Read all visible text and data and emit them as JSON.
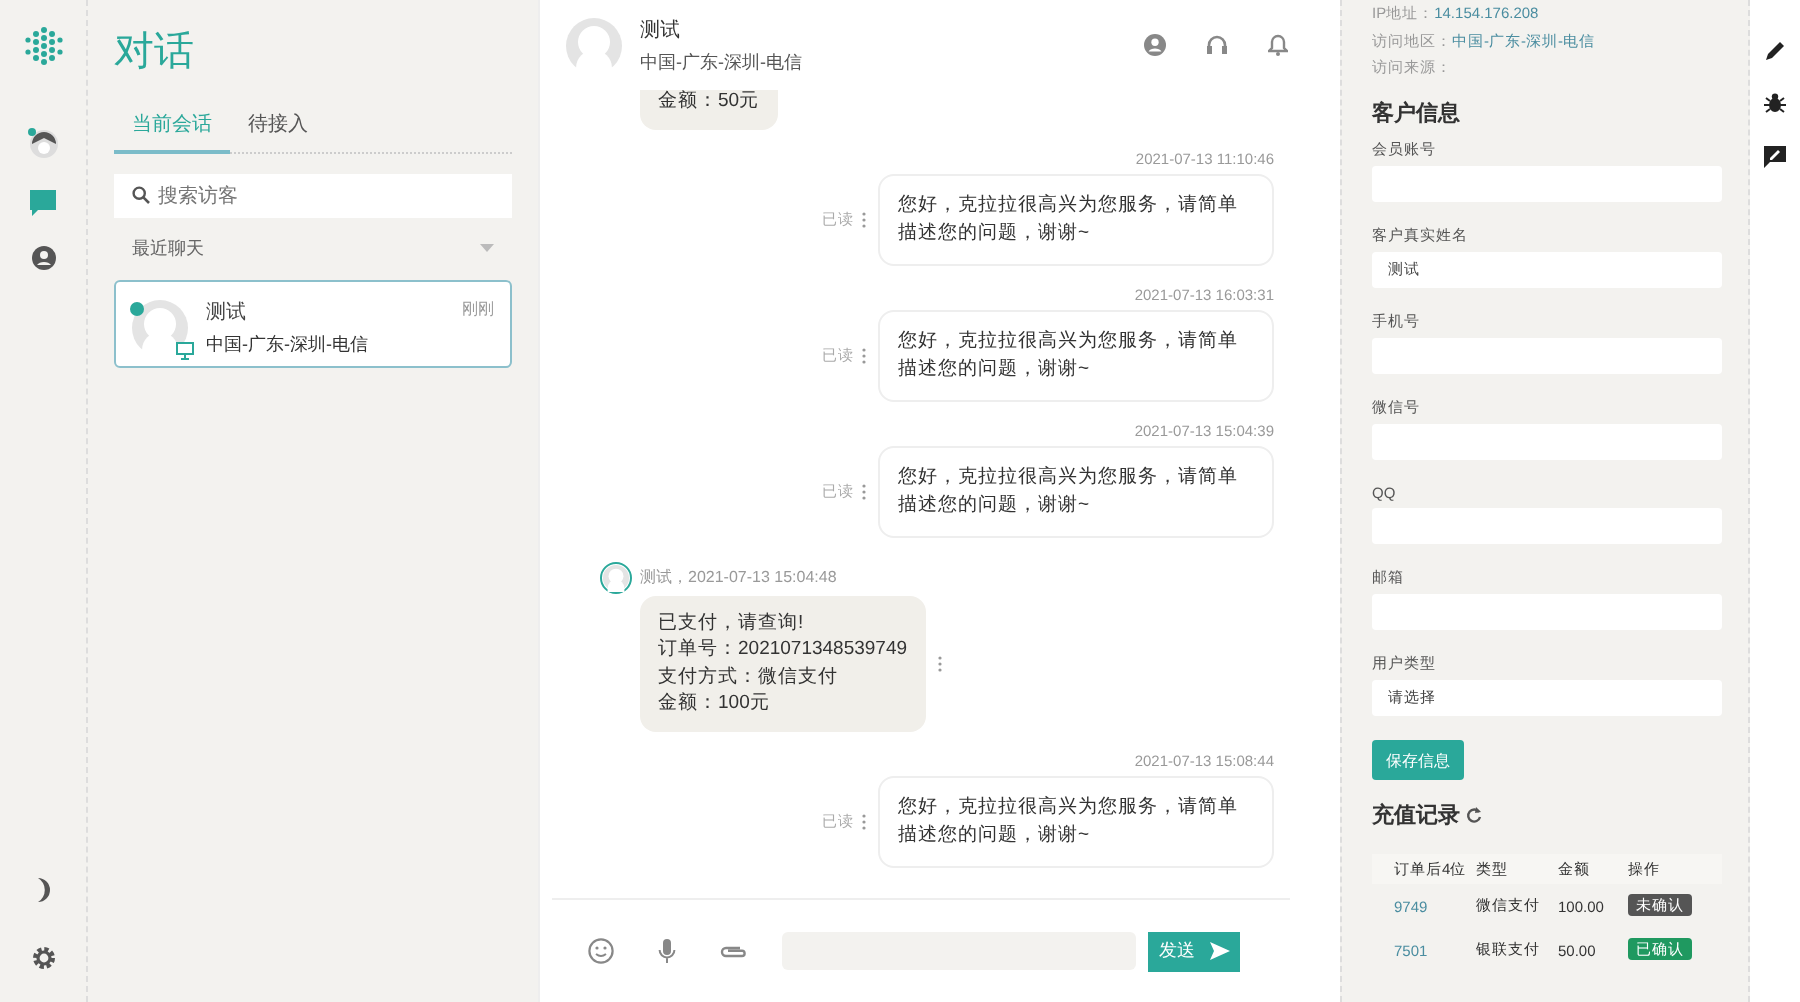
{
  "rail": {
    "items": [
      {
        "kind": "avatar",
        "selected": false
      },
      {
        "kind": "chat",
        "selected": true
      },
      {
        "kind": "profile",
        "selected": false
      }
    ],
    "bottom": [
      {
        "kind": "moon"
      },
      {
        "kind": "gear"
      }
    ]
  },
  "conversations": {
    "title": "对话",
    "tabs": [
      {
        "label": "当前会话",
        "selected": true
      },
      {
        "label": "待接入",
        "selected": false
      }
    ],
    "search": {
      "placeholder": "搜索访客"
    },
    "section": "最近聊天",
    "items": [
      {
        "name": "测试",
        "location": "中国-广东-深圳-电信",
        "time": "刚刚",
        "online": true,
        "selected": true
      }
    ]
  },
  "chat": {
    "header": {
      "name": "测试",
      "location": "中国-广东-深圳-电信"
    },
    "messages": [
      {
        "kind": "in",
        "lines": [
          "金额：50元"
        ]
      },
      {
        "kind": "out",
        "time": "2021-07-13 11:10:46",
        "status": "已读",
        "text": "您好，克拉拉很高兴为您服务，请简单描述您的问题，谢谢~"
      },
      {
        "kind": "out",
        "time": "2021-07-13 16:03:31",
        "status": "已读",
        "text": "您好，克拉拉很高兴为您服务，请简单描述您的问题，谢谢~"
      },
      {
        "kind": "out",
        "time": "2021-07-13 15:04:39",
        "status": "已读",
        "text": "您好，克拉拉很高兴为您服务，请简单描述您的问题，谢谢~"
      },
      {
        "kind": "in",
        "meta": "测试，2021-07-13 15:04:48",
        "lines": [
          "已支付，请查询!",
          "订单号：2021071348539749",
          "支付方式：微信支付",
          "金额：100元"
        ]
      },
      {
        "kind": "out",
        "time": "2021-07-13 15:08:44",
        "status": "已读",
        "text": "您好，克拉拉很高兴为您服务，请简单描述您的问题，谢谢~"
      }
    ],
    "composer": {
      "send": "发送"
    }
  },
  "customer": {
    "visit": [
      {
        "label": "IP地址：",
        "value": "14.154.176.208"
      },
      {
        "label": "访问地区：",
        "value": "中国-广东-深圳-电信"
      },
      {
        "label": "访问来源："
      }
    ],
    "title": "客户信息",
    "fields": [
      {
        "label": "会员账号"
      },
      {
        "label": "客户真实姓名",
        "value": "测试"
      },
      {
        "label": "手机号"
      },
      {
        "label": "微信号"
      },
      {
        "label": "QQ"
      },
      {
        "label": "邮箱"
      }
    ],
    "user_type": {
      "label": "用户类型",
      "value": "请选择"
    },
    "save": "保存信息",
    "recharge_title": "充值记录",
    "columns": [
      "订单后4位",
      "类型",
      "金额",
      "操作"
    ],
    "rows": [
      {
        "order": "9749",
        "type": "微信支付",
        "amount": "100.00",
        "action": "未确认",
        "confirmed": false
      },
      {
        "order": "7501",
        "type": "银联支付",
        "amount": "50.00",
        "action": "已确认",
        "confirmed": true
      }
    ]
  },
  "tools": [
    {
      "kind": "pencil"
    },
    {
      "kind": "bug"
    },
    {
      "kind": "feedback"
    }
  ]
}
